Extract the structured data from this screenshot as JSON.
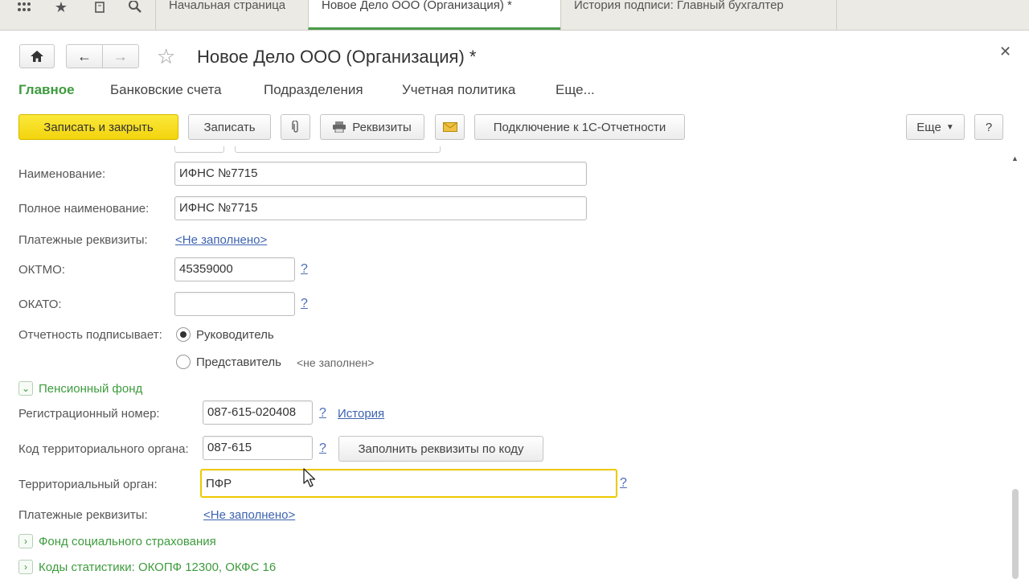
{
  "top_tabs": [
    {
      "label": "Начальная страница"
    },
    {
      "label": "Новое Дело ООО (Организация) *"
    },
    {
      "label": "История подписи: Главный бухгалтер"
    }
  ],
  "form": {
    "title": "Новое Дело ООО (Организация) *"
  },
  "nav_tabs": {
    "main": "Главное",
    "bank": "Банковские счета",
    "subdivisions": "Подразделения",
    "policy": "Учетная политика",
    "more": "Еще..."
  },
  "toolbar": {
    "save_close": "Записать и закрыть",
    "save": "Записать",
    "requisites": "Реквизиты",
    "connect": "Подключение к 1С-Отчетности",
    "more": "Еще",
    "help": "?"
  },
  "fields": {
    "name_label": "Наименование:",
    "name_value": "ИФНС №7715",
    "full_name_label": "Полное наименование:",
    "full_name_value": "ИФНС №7715",
    "payment_label": "Платежные реквизиты:",
    "payment_value": "<Не заполнено>",
    "oktmo_label": "ОКТМО:",
    "oktmo_value": "45359000",
    "okato_label": "ОКАТО:",
    "okato_value": "",
    "signer_label": "Отчетность подписывает:",
    "signer_head": "Руководитель",
    "signer_rep": "Представитель",
    "signer_rep_note": "<не заполнен>",
    "help_mark": "?"
  },
  "pension": {
    "title": "Пенсионный фонд",
    "reg_label": "Регистрационный номер:",
    "reg_value": "087-615-020408",
    "history_link": "История",
    "code_label": "Код территориального органа:",
    "code_value": "087-615",
    "fill_button": "Заполнить реквизиты по коду",
    "organ_label": "Территориальный орган:",
    "organ_value": "ПФР",
    "payment_label": "Платежные реквизиты:",
    "payment_value": "<Не заполнено>"
  },
  "groups": {
    "fss": "Фонд социального страхования",
    "stats": "Коды статистики: ОКОПФ 12300, ОКФС 16"
  }
}
